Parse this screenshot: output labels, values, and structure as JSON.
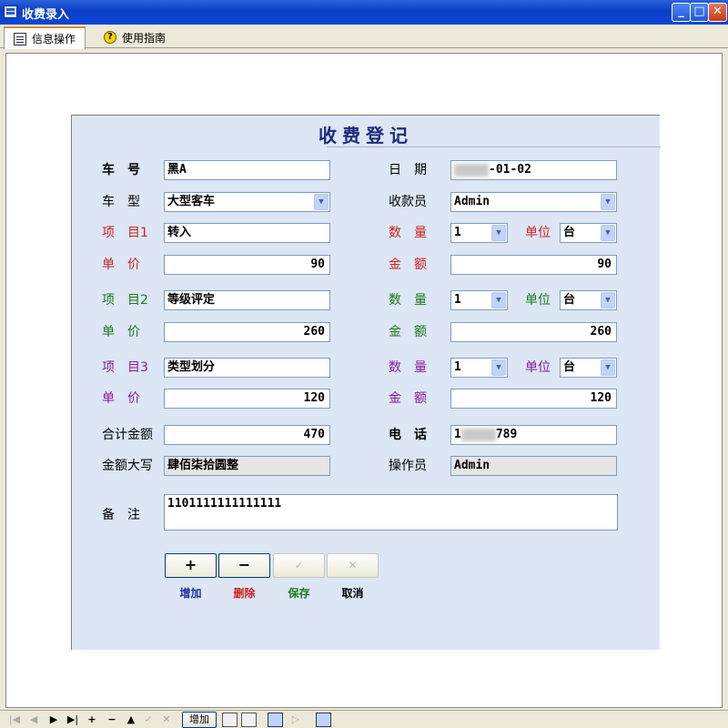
{
  "window": {
    "title": "收费录入",
    "min_label": "_",
    "max_label": "□",
    "close_label": "✕"
  },
  "tabs": [
    {
      "label": "信息操作",
      "icon": "book-icon",
      "active": true
    },
    {
      "label": "使用指南",
      "icon": "help-icon",
      "active": false
    }
  ],
  "form": {
    "title": "收费登记",
    "plate_label": "车　号",
    "plate_value": "黑A",
    "date_label": "日　期",
    "date_value_visible": "-01-02",
    "type_label": "车　型",
    "type_value": "大型客车",
    "cashier_label": "收款员",
    "cashier_value": "Admin",
    "items": [
      {
        "item_label": "项　目1",
        "item_value": "转入",
        "qty_label": "数　量",
        "qty_value": "1",
        "unit_label": "单位",
        "unit_value": "台",
        "price_label": "单　价",
        "price_value": "90",
        "amount_label": "金　额",
        "amount_value": "90"
      },
      {
        "item_label": "项　目2",
        "item_value": "等级评定",
        "qty_label": "数　量",
        "qty_value": "1",
        "unit_label": "单位",
        "unit_value": "台",
        "price_label": "单　价",
        "price_value": "260",
        "amount_label": "金　额",
        "amount_value": "260"
      },
      {
        "item_label": "项　目3",
        "item_value": "类型划分",
        "qty_label": "数　量",
        "qty_value": "1",
        "unit_label": "单位",
        "unit_value": "台",
        "price_label": "单　价",
        "price_value": "120",
        "amount_label": "金　额",
        "amount_value": "120"
      }
    ],
    "total_label": "合计金额",
    "total_value": "470",
    "phone_label": "电　话",
    "phone_prefix": "1",
    "phone_suffix": "789",
    "total_words_label": "金额大写",
    "total_words_value": "肆佰柒拾圆整",
    "operator_label": "操作员",
    "operator_value": "Admin",
    "remark_label": "备　注",
    "remark_value": "1101111111111111"
  },
  "actions": {
    "add_icon": "+",
    "delete_icon": "−",
    "save_icon": "✓",
    "cancel_icon": "✕",
    "add_label": "增加",
    "delete_label": "删除",
    "save_label": "保存",
    "cancel_label": "取消"
  },
  "navbar": {
    "first": "|◀",
    "prev": "◀",
    "next": "▶",
    "last": "▶|",
    "plus": "+",
    "minus": "−",
    "up": "▲",
    "check": "✓",
    "cross": "✕",
    "add_button_label": "增加"
  },
  "colors": {
    "titlebar": "#0a3fc4",
    "form_bg": "#dce6f5",
    "group1": "#d12020",
    "group2": "#1a7a1a",
    "group3": "#8a1a9a"
  }
}
